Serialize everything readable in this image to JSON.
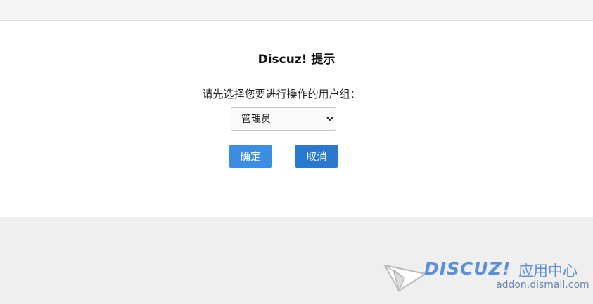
{
  "dialog": {
    "title": "Discuz! 提示",
    "prompt": "请先选择您要进行操作的用户组：",
    "select": {
      "selected": "管理员",
      "options": [
        "管理员"
      ]
    },
    "confirm_label": "确定",
    "cancel_label": "取消"
  },
  "watermark": {
    "brand": "DISCUZ!",
    "brand_cn": "应用中心",
    "domain": "addon.dismall.com"
  },
  "colors": {
    "confirm_button": "#3d8ee0",
    "cancel_button": "#2b78cf",
    "watermark": "#5c8fd6"
  }
}
